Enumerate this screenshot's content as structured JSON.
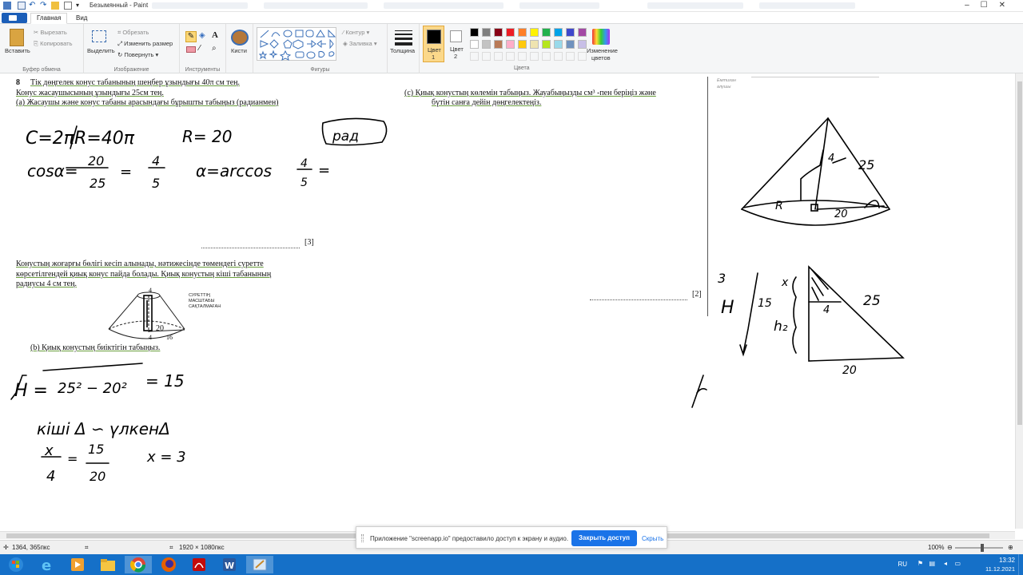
{
  "window": {
    "title": "Безымянный - Paint"
  },
  "ribbon": {
    "tabs": [
      "Главная",
      "Вид"
    ],
    "clipboard": {
      "paste": "Вставить",
      "cut": "Вырезать",
      "copy": "Копировать",
      "label": "Буфер обмена"
    },
    "image": {
      "select": "Выделить",
      "crop": "Обрезать",
      "resize": "Изменить размер",
      "rotate": "Повернуть",
      "label": "Изображение"
    },
    "tools": {
      "label": "Инструменты"
    },
    "brushes": {
      "label": "Кисти"
    },
    "shapes": {
      "outline": "Контур",
      "fill": "Заливка",
      "label": "Фигуры"
    },
    "thickness": {
      "label": "Толщина"
    },
    "color1": {
      "label1": "Цвет",
      "label2": "1"
    },
    "color2": {
      "label1": "Цвет",
      "label2": "2"
    },
    "colors": {
      "label": "Цвета",
      "edit1": "Изменение",
      "edit2": "цветов",
      "row1": [
        "#000000",
        "#7f7f7f",
        "#880015",
        "#ed1c24",
        "#ff7f27",
        "#fff200",
        "#22b14c",
        "#00a2e8",
        "#3f48cc",
        "#a349a4"
      ],
      "row2": [
        "#ffffff",
        "#c3c3c3",
        "#b97a57",
        "#ffaec9",
        "#ffc90e",
        "#efe4b0",
        "#b5e61d",
        "#99d9ea",
        "#7092be",
        "#c8bfe7"
      ]
    }
  },
  "document": {
    "q_num": "8",
    "line1": "Тік дөңгелек конус табанының шеңбер ұзындығы 40π см тең.",
    "line2": "Конус жасаушысының ұзындығы 25см тең.",
    "line3": "(a) Жасаушы және конус табаны арасындағы бұрышты табыңыз (радианмен)",
    "mark3": "[3]",
    "para1": "Конустың жоғарғы бөлігі кесіп алынады, нәтижесінде төмендегі суретте",
    "para2": "көрсетілгендей қиық конус пайда болады. Қиық конустың кіші табанының",
    "para3": "радиусы 4 см тең.",
    "fig_note1": "СУРЕТТІҢ",
    "fig_note2": "МАСШТАБЫ",
    "fig_note3": "САҚТАЛМАҒАН",
    "part_b": "(b) Қиық конустың биіктігін табыңыз.",
    "part_c1": "(c) Қиық конустың көлемін табыңыз. Жауабыңызды см³ -пен беріңіз және",
    "part_c2": "бүтін санға дейін дөңгелектеңіз.",
    "mark2": "[2]",
    "margin1": "Емтихан",
    "margin2": "алушы",
    "fig_top": "4",
    "fig_r": "20",
    "fig_b1": "4",
    "fig_b2": "16"
  },
  "handwriting": {
    "c_eq": "C=2πR=40π",
    "r_eq": "R= 20",
    "rad": "рад",
    "cos_eq": "cosα=",
    "f1n": "20",
    "f1d": "25",
    "f2n": "4",
    "f2d": "5",
    "alpha": "α=arccos",
    "f3n": "4",
    "f3d": "5",
    "h_eq": "H =",
    "h_res": "= 15",
    "sim": "кіші Δ ∽ үлкенΔ",
    "xn": "x",
    "xd": "4",
    "yn": "15",
    "yd": "20",
    "x_res": "x = 3",
    "c25": "25",
    "cr": "R",
    "c20": "20",
    "c4": "4",
    "t3": "3",
    "tH": "H",
    "t15": "15",
    "tx": "x",
    "th2": "h₂",
    "t4": "4",
    "t25": "25",
    "t20": "20"
  },
  "statusbar": {
    "coords": "1364, 365пкс",
    "size": "1920 × 1080пкс",
    "zoom": "100%"
  },
  "share": {
    "text": "Приложение \"screenapp.io\" предоставило доступ к экрану и аудио.",
    "button": "Закрыть доступ",
    "hide": "Скрыть"
  },
  "taskbar": {
    "lang": "RU",
    "time": "13:32",
    "date": "11.12.2021"
  }
}
